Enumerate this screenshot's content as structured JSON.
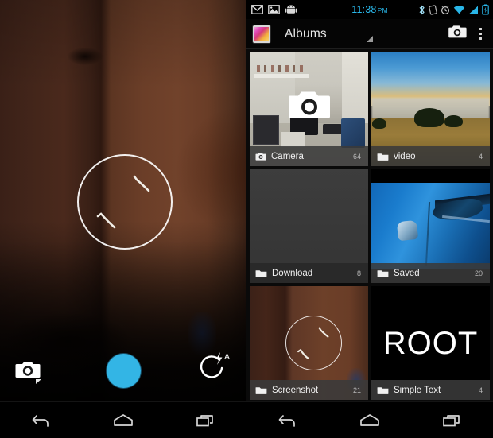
{
  "camera": {
    "viewfinder_alt": "dark dim room camera preview",
    "focus_ring": "focus-exposure-ring",
    "mode_switch_label": "camera-mode",
    "shutter_label": "shutter",
    "shutter_color": "#33b5e5",
    "flash_label": "flash-auto",
    "flash_mode": "A"
  },
  "gallery": {
    "statusbar": {
      "time": "11:38",
      "ampm": "PM",
      "time_color": "#29b6e8",
      "left_icons": [
        "gmail-icon",
        "photo-icon",
        "android-icon"
      ],
      "right_icons": [
        "bluetooth-icon",
        "nfc-icon",
        "alarm-icon",
        "wifi-icon",
        "signal-icon",
        "battery-icon"
      ]
    },
    "actionbar": {
      "app_icon": "gallery-app-icon",
      "title": "Albums",
      "spinner_caret": "dropdown-caret-icon",
      "camera_action": "camera-icon",
      "overflow_action": "overflow-menu-icon"
    },
    "albums": [
      {
        "name": "Camera",
        "count": "64",
        "icon": "camera-icon",
        "thumb": "room-interior"
      },
      {
        "name": "video",
        "count": "4",
        "icon": "folder-icon",
        "thumb": "sunset-landscape"
      },
      {
        "name": "Download",
        "count": "8",
        "icon": "folder-icon",
        "thumb": "blank"
      },
      {
        "name": "Saved",
        "count": "20",
        "icon": "folder-icon",
        "thumb": "blue-car"
      },
      {
        "name": "Screenshot",
        "count": "21",
        "icon": "folder-icon",
        "thumb": "camera-screenshot"
      },
      {
        "name": "Simple Text",
        "count": "4",
        "icon": "folder-icon",
        "thumb": "root-text",
        "thumb_text": "ROOT"
      }
    ]
  },
  "navbar": {
    "back_label": "back",
    "home_label": "home",
    "recents_label": "recent-apps"
  }
}
